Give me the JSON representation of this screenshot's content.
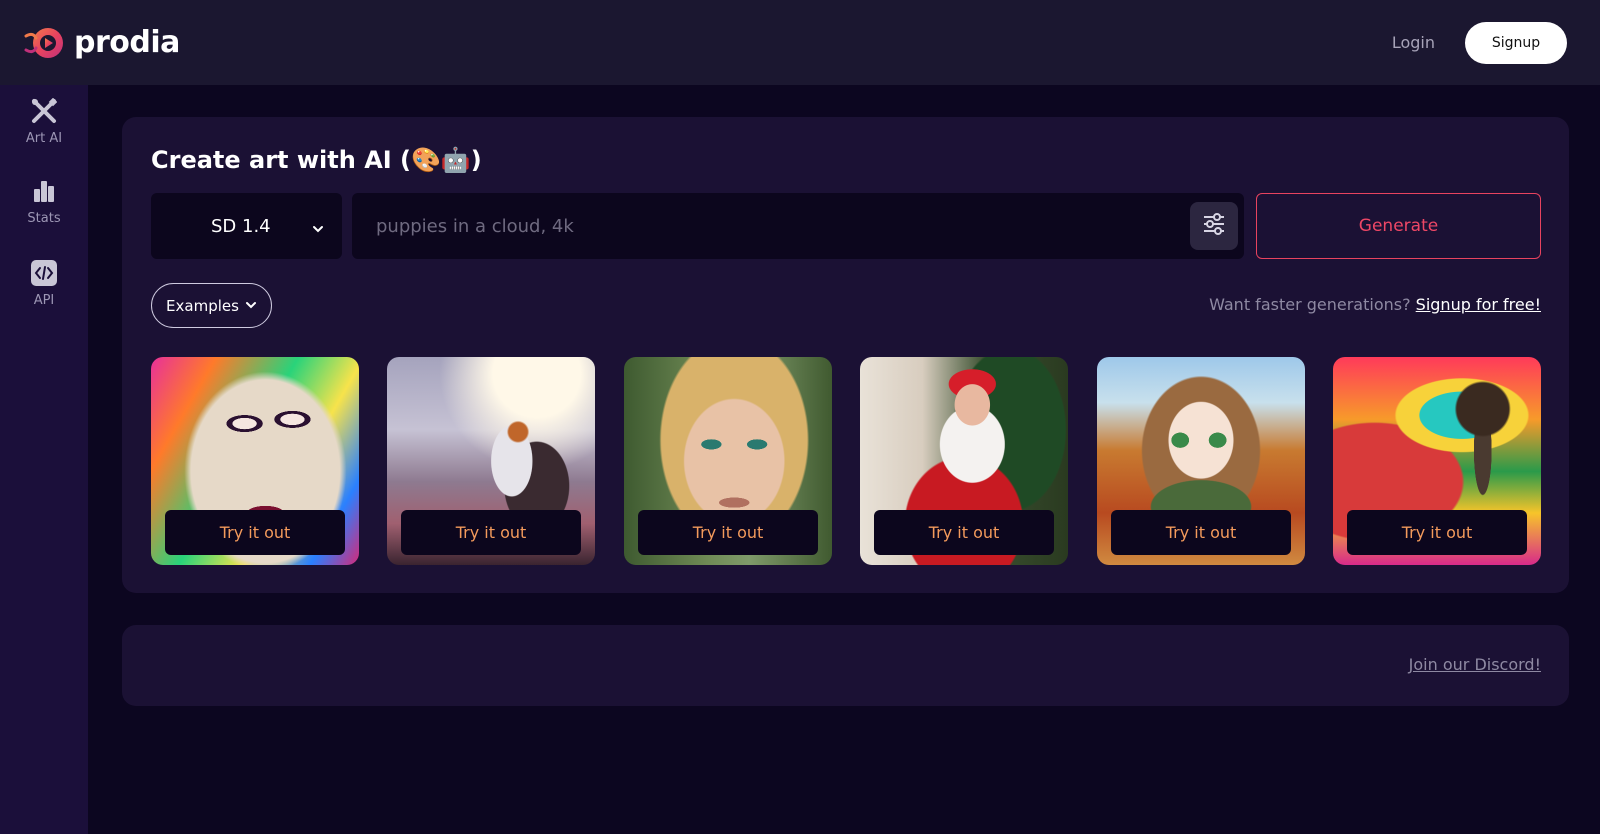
{
  "header": {
    "brand": "prodia",
    "login_label": "Login",
    "signup_label": "Signup"
  },
  "sidebar": {
    "items": [
      {
        "label": "Art AI",
        "icon": "brush-pencil-icon"
      },
      {
        "label": "Stats",
        "icon": "bar-chart-icon"
      },
      {
        "label": "API",
        "icon": "code-icon"
      }
    ]
  },
  "main": {
    "title": "Create art with AI (🎨🤖)",
    "model_select": "SD 1.4",
    "prompt_placeholder": "puppies in a cloud, 4k",
    "prompt_value": "",
    "generate_label": "Generate",
    "examples_label": "Examples",
    "faster_text": "Want faster generations?",
    "signup_link": "Signup for free!",
    "examples": [
      {
        "name": "colorful-woman-portrait",
        "button": "Try it out"
      },
      {
        "name": "astronaut-on-horse",
        "button": "Try it out"
      },
      {
        "name": "blonde-woman-portrait",
        "button": "Try it out"
      },
      {
        "name": "santa-claus",
        "button": "Try it out"
      },
      {
        "name": "anime-girl-autumn",
        "button": "Try it out"
      },
      {
        "name": "psychedelic-landscape",
        "button": "Try it out"
      }
    ]
  },
  "footer": {
    "discord_link": "Join our Discord!"
  },
  "colors": {
    "accent": "#ee4766",
    "try_text": "#f39a5c",
    "background": "#0c0620",
    "card": "#1b1134"
  }
}
